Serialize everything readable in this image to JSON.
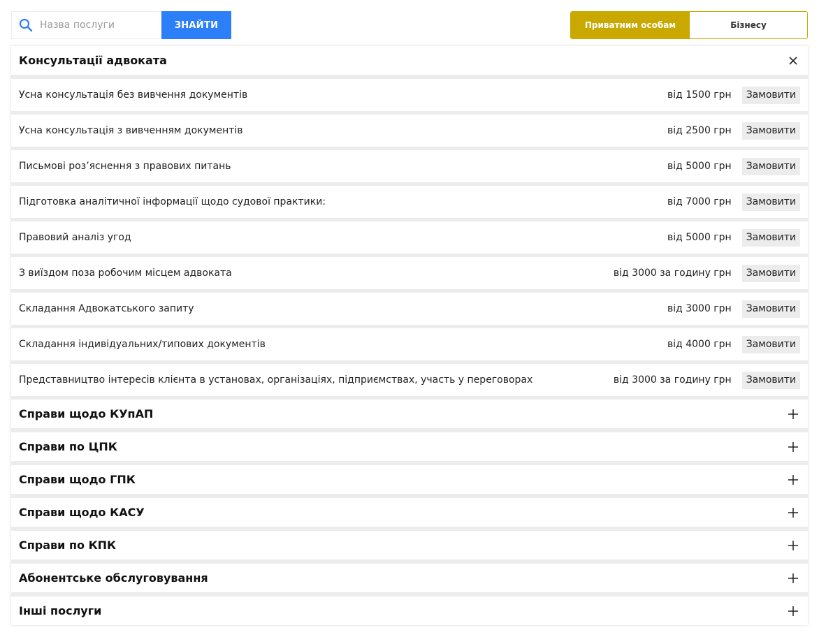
{
  "search": {
    "placeholder": "Назва послуги",
    "button_label": "ЗНАЙТИ"
  },
  "audience": {
    "selected": "Приватним особам",
    "options": [
      "Приватним особам",
      "Бізнесу"
    ]
  },
  "open_section": {
    "title": "Консультації адвоката",
    "services": [
      {
        "name": "Усна консультація без вивчення документів",
        "price": "від 1500 грн",
        "order_label": "Замовити"
      },
      {
        "name": "Усна консультація з вивченням документів",
        "price": "від 2500 грн",
        "order_label": "Замовити"
      },
      {
        "name": "Письмові роз’яснення з правових питань",
        "price": "від 5000 грн",
        "order_label": "Замовити"
      },
      {
        "name": "Підготовка аналітичної інформації щодо судової практики:",
        "price": "від 7000 грн",
        "order_label": "Замовити"
      },
      {
        "name": "Правовий аналіз угод",
        "price": "від 5000 грн",
        "order_label": "Замовити"
      },
      {
        "name": "З виїздом поза робочим місцем адвоката",
        "price": "від 3000 за годину грн",
        "order_label": "Замовити"
      },
      {
        "name": "Складання Адвокатського запиту",
        "price": "від 3000 грн",
        "order_label": "Замовити"
      },
      {
        "name": "Складання індивідуальних/типових документів",
        "price": "від 4000 грн",
        "order_label": "Замовити"
      },
      {
        "name": "Представництво інтересів клієнта в установах, організаціях, підприємствах, участь у переговорах",
        "price": "від 3000 за годину грн",
        "order_label": "Замовити"
      }
    ]
  },
  "collapsed_sections": [
    {
      "title": "Справи щодо КУпАП"
    },
    {
      "title": "Справи по ЦПК"
    },
    {
      "title": "Справи щодо ГПК"
    },
    {
      "title": "Справи щодо КАСУ"
    },
    {
      "title": "Справи по КПК"
    },
    {
      "title": "Абонентське обслуговування"
    },
    {
      "title": "Інші послуги"
    }
  ],
  "colors": {
    "accent_blue": "#2d7ff9",
    "accent_gold": "#c9a800"
  },
  "icons": {
    "search": "search-icon",
    "close": "close-icon",
    "expand": "plus-icon"
  }
}
